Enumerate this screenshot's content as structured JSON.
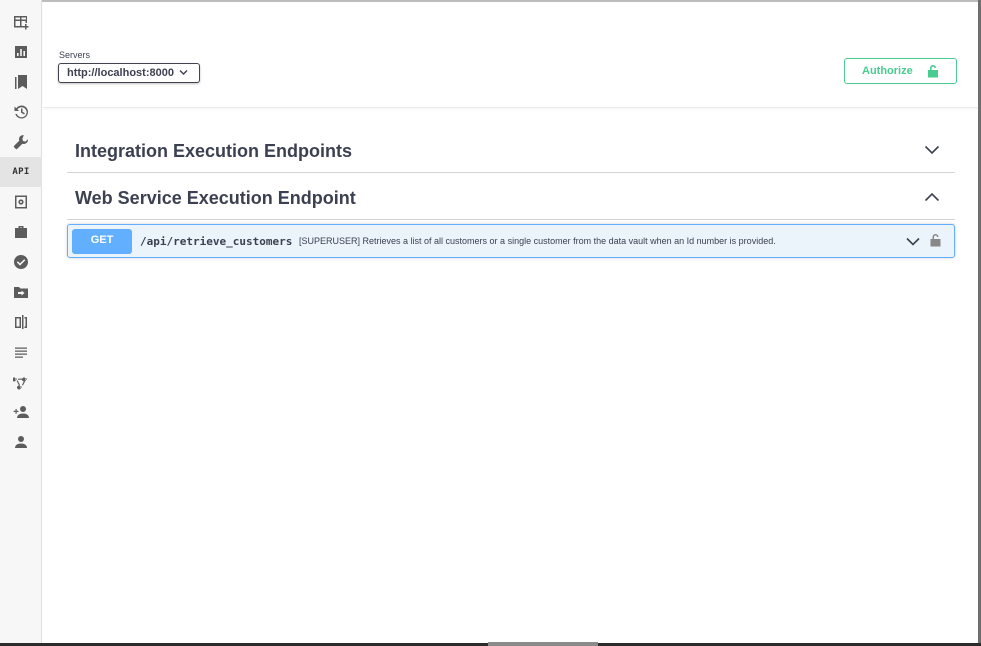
{
  "sidebar": {
    "items": [
      {
        "icon": "table-add-icon"
      },
      {
        "icon": "bar-chart-icon"
      },
      {
        "icon": "bookmarks-icon"
      },
      {
        "icon": "history-icon"
      },
      {
        "icon": "wrench-icon"
      },
      {
        "icon": "api-icon",
        "label": "API",
        "active": true
      },
      {
        "icon": "vault-icon"
      },
      {
        "icon": "briefcase-icon"
      },
      {
        "icon": "check-circle-icon"
      },
      {
        "icon": "folder-move-icon"
      },
      {
        "icon": "document-compare-icon"
      },
      {
        "icon": "lines-icon"
      },
      {
        "icon": "integration-nodes-icon"
      },
      {
        "icon": "add-user-icon"
      },
      {
        "icon": "user-icon"
      }
    ]
  },
  "servers": {
    "label": "Servers",
    "selected": "http://localhost:8000"
  },
  "authorize": {
    "label": "Authorize",
    "color": "#49cc90"
  },
  "tags": [
    {
      "title": "Integration Execution Endpoints",
      "expanded": false
    },
    {
      "title": "Web Service Execution Endpoint",
      "expanded": true
    }
  ],
  "operations": [
    {
      "method": "GET",
      "method_color": "#61affe",
      "path": "/api/retrieve_customers",
      "summary": "[SUPERUSER] Retrieves a list of all customers or a single customer from the data vault when an Id number is provided."
    }
  ]
}
